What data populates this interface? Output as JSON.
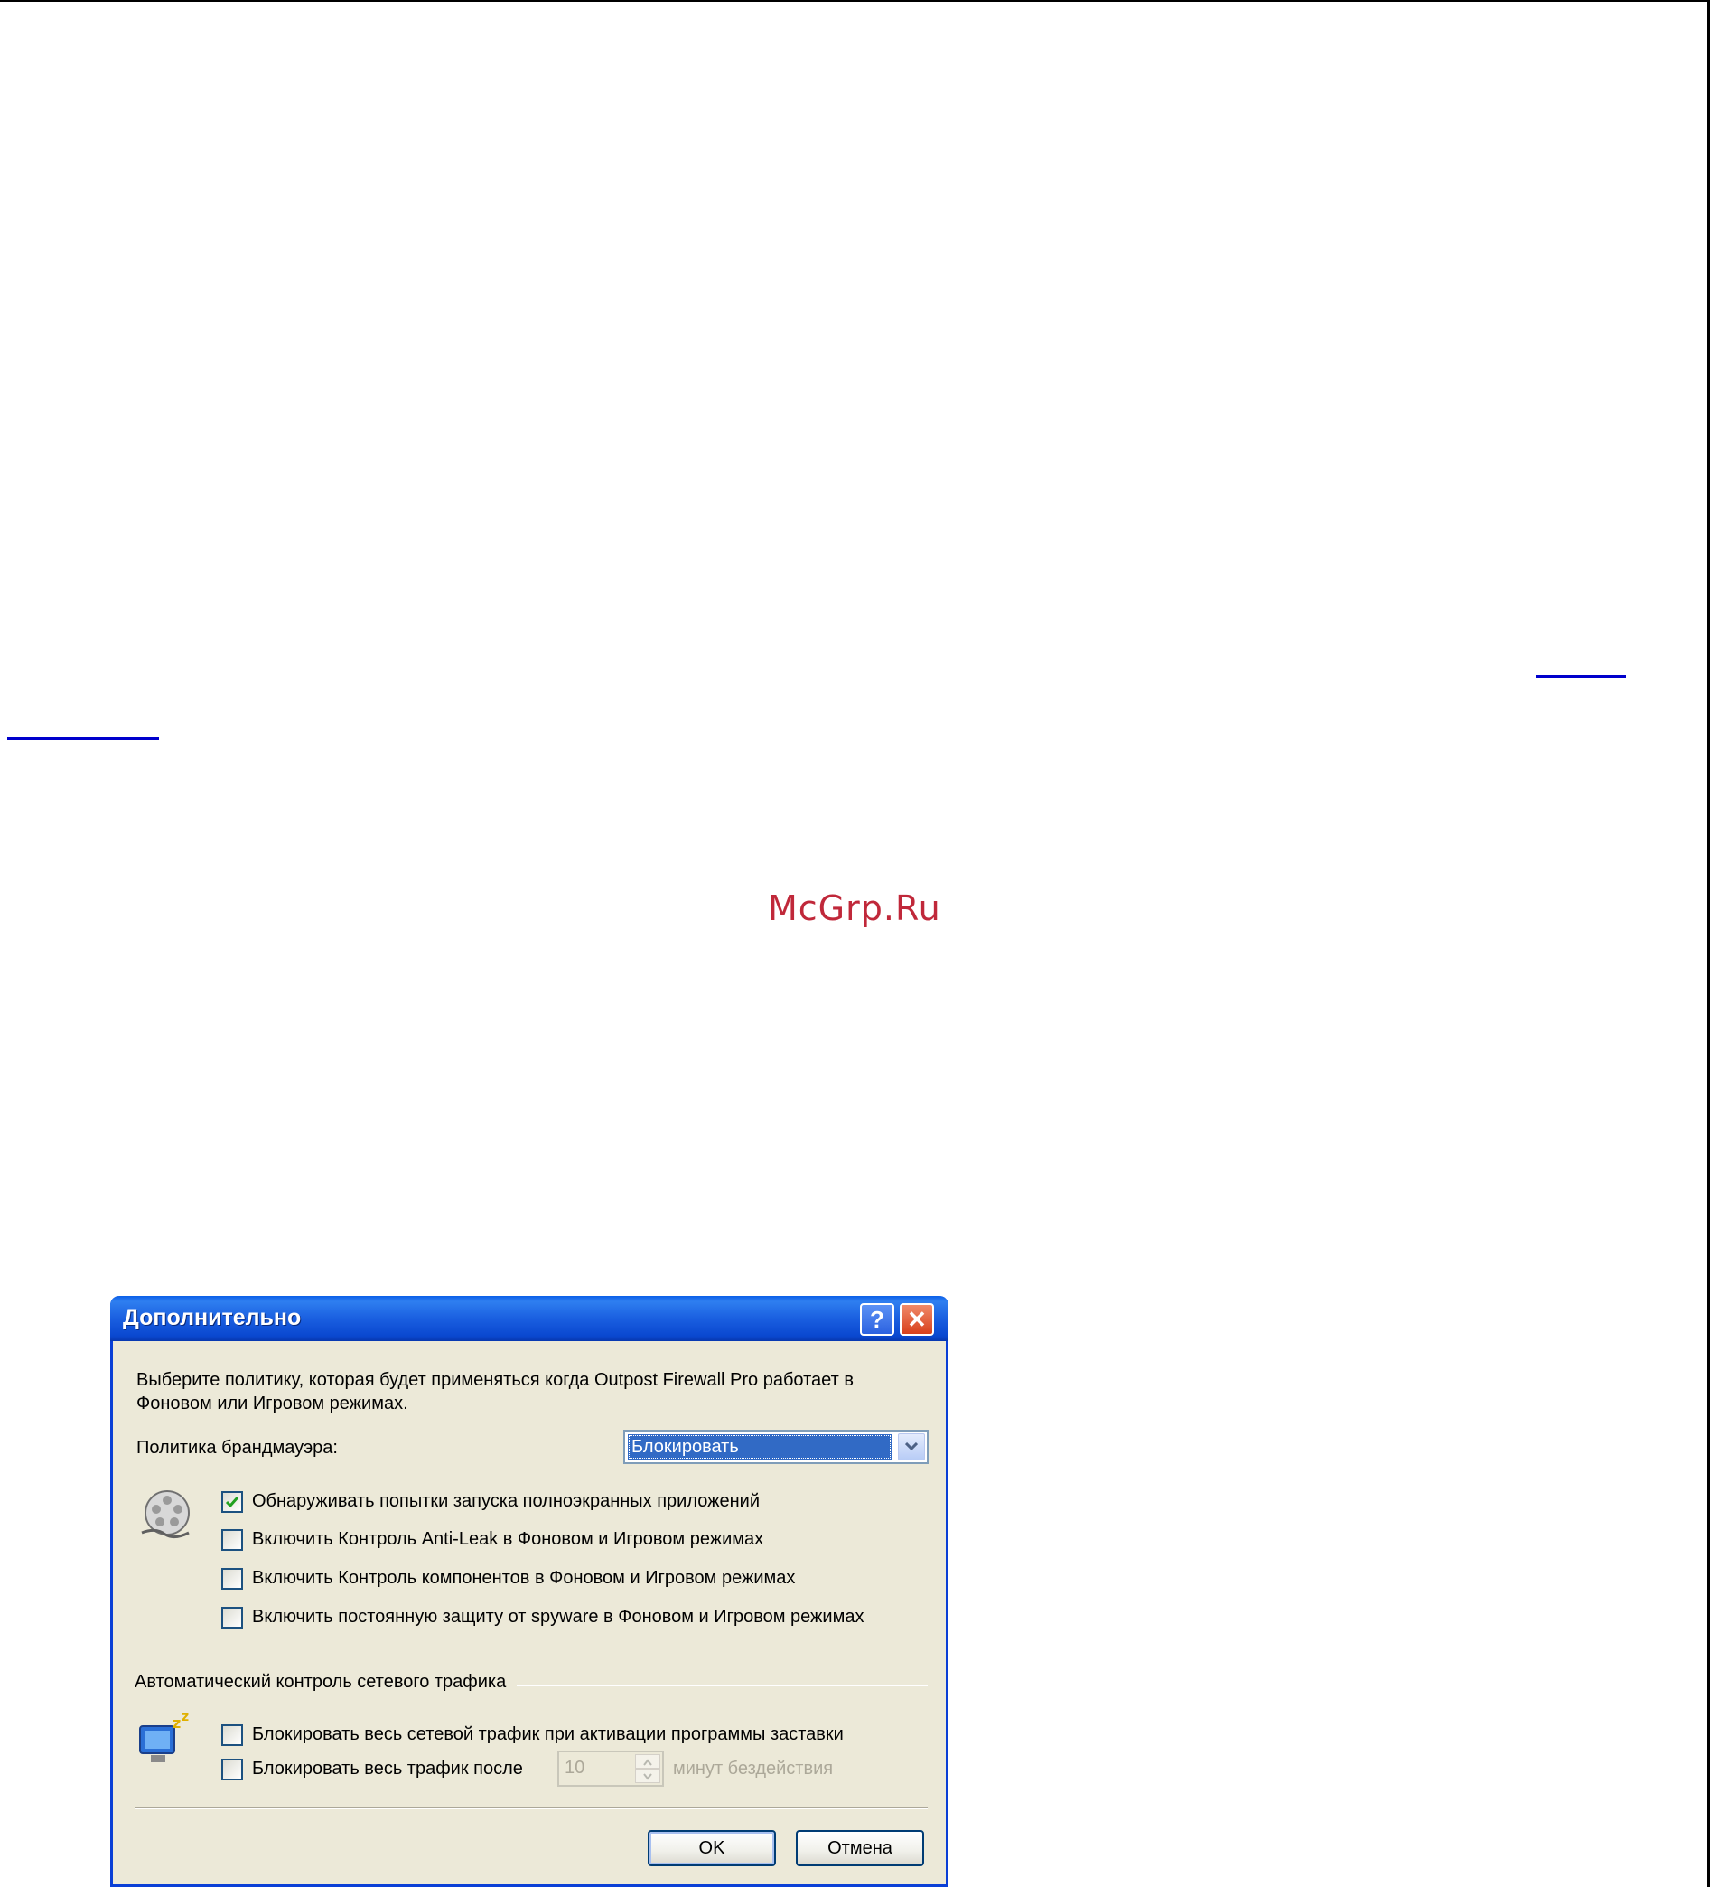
{
  "page": {
    "watermark": "McGrp.Ru"
  },
  "dialog": {
    "title": "Дополнительно",
    "help_glyph": "?",
    "close_glyph": "✕",
    "intro_text": "Выберите политику, которая будет применяться когда Outpost Firewall Pro работает в Фоновом или Игровом режимах.",
    "policy_label": "Политика брандмауэра:",
    "policy_value": "Блокировать",
    "checkboxes": [
      {
        "label": "Обнаруживать попытки запуска полноэкранных приложений",
        "checked": true
      },
      {
        "label": "Включить Контроль Anti-Leak в Фоновом и Игровом режимах",
        "checked": false
      },
      {
        "label": "Включить Контроль компонентов в Фоновом и Игровом режимах",
        "checked": false
      },
      {
        "label": "Включить постоянную защиту от spyware в Фоновом и Игровом режимах",
        "checked": false
      }
    ],
    "traffic_group": {
      "title": "Автоматический контроль сетевого трафика",
      "screensaver_label": "Блокировать весь сетевой трафик при активации программы заставки",
      "screensaver_checked": false,
      "idle_label": "Блокировать весь трафик после",
      "idle_checked": false,
      "idle_minutes": "10",
      "idle_suffix": "минут бездействия"
    },
    "ok_label": "OK",
    "cancel_label": "Отмена"
  },
  "colors": {
    "titlebar": "#0a48d0",
    "dialog_bg": "#ece9d8",
    "selection": "#316ac5",
    "watermark": "#c0283a"
  }
}
